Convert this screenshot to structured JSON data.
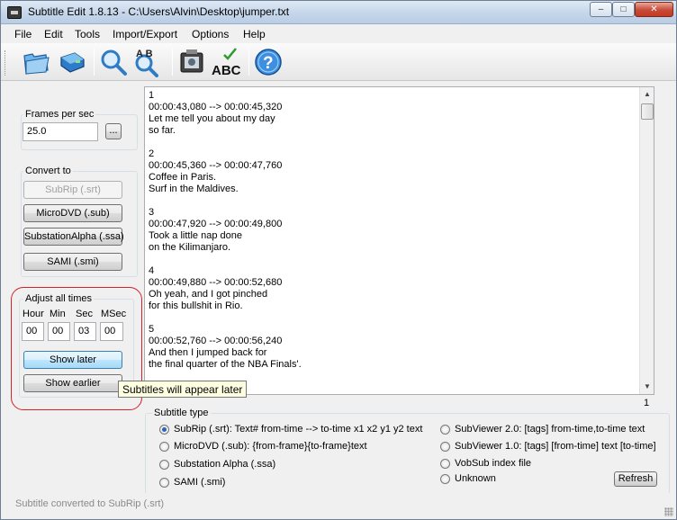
{
  "window": {
    "title": "Subtitle Edit 1.8.13 - C:\\Users\\Alvin\\Desktop\\jumper.txt",
    "min_glyph": "–",
    "max_glyph": "□",
    "close_glyph": "✕"
  },
  "menu": [
    "File",
    "Edit",
    "Tools",
    "Import/Export",
    "Options",
    "Help"
  ],
  "toolbar": {
    "icons": [
      "open-folder-icon",
      "save-disk-icon",
      "find-magnifier-icon",
      "replace-magnifier-icon",
      "visual-sync-film-icon",
      "spell-check-abc-icon",
      "help-question-icon"
    ],
    "spellcheck_text": "ABC",
    "replace_text": "A B",
    "help_text": "?"
  },
  "fps": {
    "label": "Frames per sec",
    "value": "25.0",
    "browse_label": "..."
  },
  "convert": {
    "label": "Convert to",
    "buttons": [
      "SubRip (.srt)",
      "MicroDVD (.sub)",
      "SubstationAlpha (.ssa)",
      "SAMI (.smi)"
    ]
  },
  "adjust": {
    "label": "Adjust all times",
    "headers": [
      "Hour",
      "Min",
      "Sec",
      "MSec"
    ],
    "values": [
      "00",
      "00",
      "03",
      "00"
    ],
    "show_later": "Show later",
    "show_earlier": "Show earlier",
    "tooltip": "Subtitles will appear later"
  },
  "editor": {
    "text": "1\n00:00:43,080 --> 00:00:45,320\nLet me tell you about my day\nso far.\n\n2\n00:00:45,360 --> 00:00:47,760\nCoffee in Paris.\nSurf in the Maldives.\n\n3\n00:00:47,920 --> 00:00:49,800\nTook a little nap done\non the Kilimanjaro.\n\n4\n00:00:49,880 --> 00:00:52,680\nOh yeah, and I got pinched\nfor this bullshit in Rio.\n\n5\n00:00:52,760 --> 00:00:56,240\nAnd then I jumped back for\nthe final quarter of the NBA Finals'.",
    "line_number": "1"
  },
  "subtitle_type": {
    "label": "Subtitle type",
    "options": [
      {
        "label": "SubRip (.srt): Text#   from-time --> to-time x1 x2 y1 y2   text",
        "checked": true
      },
      {
        "label": "MicroDVD (.sub): {from-frame}{to-frame}text",
        "checked": false
      },
      {
        "label": "Substation Alpha (.ssa)",
        "checked": false
      },
      {
        "label": "SAMI (.smi)",
        "checked": false
      },
      {
        "label": "SubViewer 2.0: [tags]   from-time,to-time   text",
        "checked": false
      },
      {
        "label": "SubViewer 1.0: [tags]   [from-time]   text   [to-time]",
        "checked": false
      },
      {
        "label": "VobSub index file",
        "checked": false
      },
      {
        "label": "Unknown",
        "checked": false
      }
    ],
    "refresh": "Refresh"
  },
  "status": "Subtitle converted to SubRip (.srt)",
  "colors": {
    "accent_blue": "#2a63b8",
    "annotation_red": "#d2222a",
    "tooltip_bg": "#ffffe1"
  }
}
